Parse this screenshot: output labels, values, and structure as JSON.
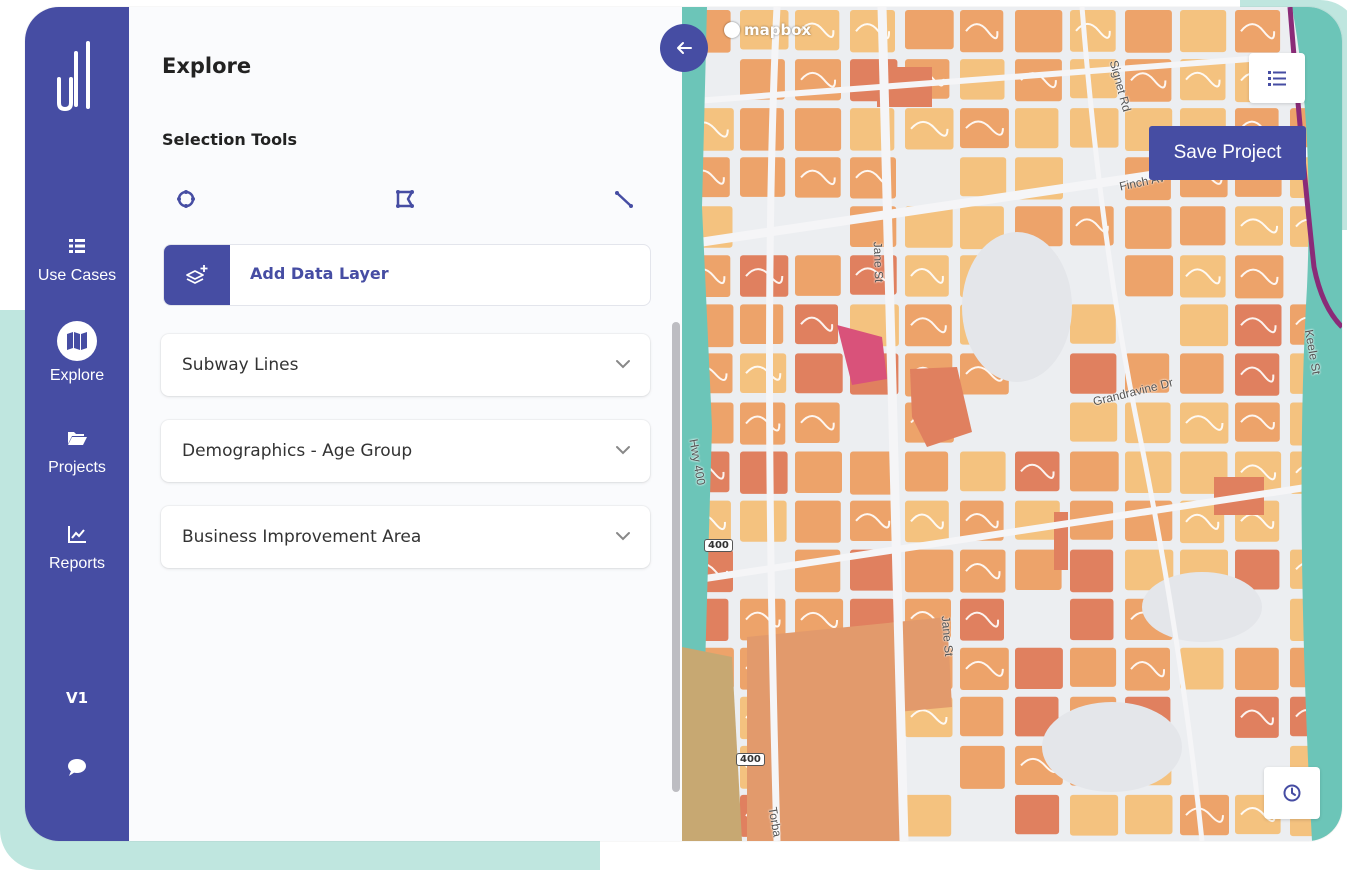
{
  "nav": {
    "items": [
      {
        "label": "Use Cases",
        "icon": "list-icon"
      },
      {
        "label": "Explore",
        "icon": "map-icon"
      },
      {
        "label": "Projects",
        "icon": "folder-icon"
      },
      {
        "label": "Reports",
        "icon": "chart-icon"
      }
    ],
    "active": "Explore",
    "version": "V1"
  },
  "panel": {
    "title": "Explore",
    "selection_tools": {
      "title": "Selection Tools",
      "tools": [
        "circle-select-icon",
        "polygon-select-icon",
        "line-select-icon"
      ]
    },
    "add_layer_label": "Add Data Layer",
    "layers": [
      {
        "label": "Subway Lines"
      },
      {
        "label": "Demographics - Age Group"
      },
      {
        "label": "Business Improvement Area"
      }
    ]
  },
  "map": {
    "attribution": "mapbox",
    "labels": {
      "jane_st_1": "Jane St",
      "jane_st_2": "Jane St",
      "finch_ave": "Finch Av",
      "grandravine": "Grandravine Dr",
      "signet_rd": "Signet Rd",
      "hwy_400": "Hwy 400",
      "keele_st": "Keele St",
      "torbarrie": "Torba"
    },
    "shields": [
      "400",
      "400"
    ],
    "save_label": "Save Project"
  },
  "colors": {
    "brand": "#464da3",
    "block_light": "#f4c27f",
    "block_mid": "#eda36a",
    "block_dark": "#e0805f",
    "block_hot": "#d9527a",
    "water": "#6cc5b8"
  }
}
